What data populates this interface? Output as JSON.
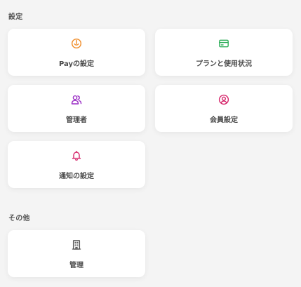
{
  "sections": [
    {
      "title": "設定",
      "cards": [
        {
          "label": "Payの設定",
          "icon": "pay-icon",
          "color": "#f08a24"
        },
        {
          "label": "プランと使用状況",
          "icon": "credit-card-icon",
          "color": "#2fae5a"
        },
        {
          "label": "管理者",
          "icon": "users-icon",
          "color": "#9b2fc5"
        },
        {
          "label": "会員設定",
          "icon": "user-circle-icon",
          "color": "#d6266b"
        },
        {
          "label": "通知の設定",
          "icon": "bell-icon",
          "color": "#d6266b"
        }
      ]
    },
    {
      "title": "その他",
      "cards": [
        {
          "label": "管理",
          "icon": "building-icon",
          "color": "#555555"
        }
      ]
    }
  ]
}
